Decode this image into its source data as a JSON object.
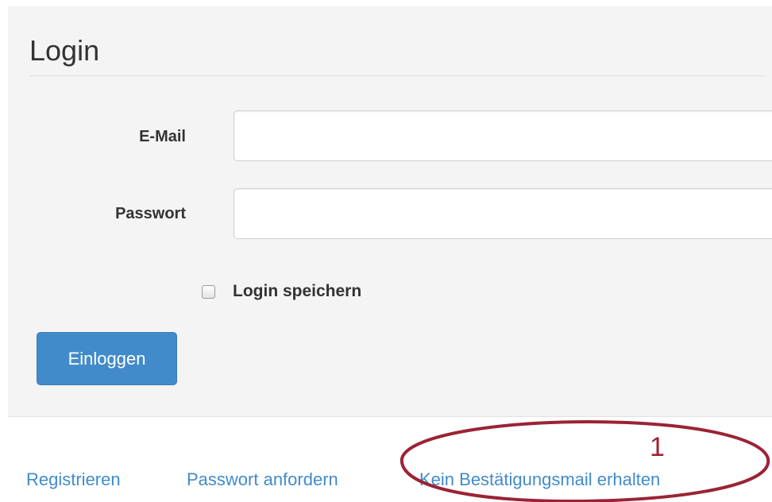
{
  "login": {
    "title": "Login",
    "email_label": "E-Mail",
    "email_value": "",
    "password_label": "Passwort",
    "password_value": "",
    "remember_label": "Login speichern",
    "remember_checked": false,
    "submit_label": "Einloggen"
  },
  "links": {
    "register": "Registrieren",
    "request_password": "Passwort anfordern",
    "no_confirmation_mail": "Kein Bestätigungsmail erhalten"
  },
  "annotation": {
    "number": "1"
  },
  "colors": {
    "panel_background": "#f4f4f4",
    "primary_button": "#428bca",
    "link": "#428bca",
    "annotation": "#9b2335"
  }
}
